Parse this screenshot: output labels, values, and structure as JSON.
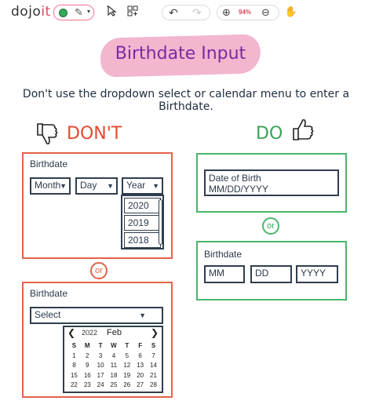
{
  "toolbar": {
    "logo_main": "dojo",
    "logo_accent": "it",
    "zoom": "94%",
    "icons": [
      "color-dot",
      "pen-icon",
      "select-cursor-icon",
      "grid-icon",
      "undo-icon",
      "redo-icon",
      "zoom-in-icon",
      "zoom-out-icon",
      "hand-icon"
    ]
  },
  "title": "Birthdate Input",
  "subtitle": "Don't use the dropdown select or calendar menu to enter a Birthdate.",
  "dont": {
    "heading": "DON'T",
    "panel1": {
      "label": "Birthdate",
      "month": "Month",
      "day": "Day",
      "year": "Year",
      "year_options": [
        "2020",
        "2019",
        "2018"
      ]
    },
    "or": "or",
    "panel2": {
      "label": "Birthdate",
      "select": "Select",
      "calendar": {
        "year": "2022",
        "month": "Feb",
        "weekdays": [
          "S",
          "M",
          "T",
          "W",
          "T",
          "F",
          "S"
        ],
        "weeks": [
          [
            "1",
            "2",
            "3",
            "4",
            "5",
            "6",
            "7"
          ],
          [
            "8",
            "9",
            "10",
            "11",
            "12",
            "13",
            "14"
          ],
          [
            "15",
            "16",
            "17",
            "18",
            "19",
            "20",
            "21"
          ],
          [
            "22",
            "23",
            "24",
            "25",
            "26",
            "27",
            "28"
          ]
        ]
      }
    }
  },
  "do": {
    "heading": "DO",
    "panel1": {
      "label": "Date of Birth",
      "value": "MM/DD/YYYY"
    },
    "or": "or",
    "panel2": {
      "label": "Birthdate",
      "mm": "MM",
      "dd": "DD",
      "yyyy": "YYYY"
    }
  },
  "colors": {
    "dont": "#e64a2e",
    "do": "#3aa35a",
    "title": "#7a2aa0",
    "title_bg": "#f2b6cf"
  }
}
